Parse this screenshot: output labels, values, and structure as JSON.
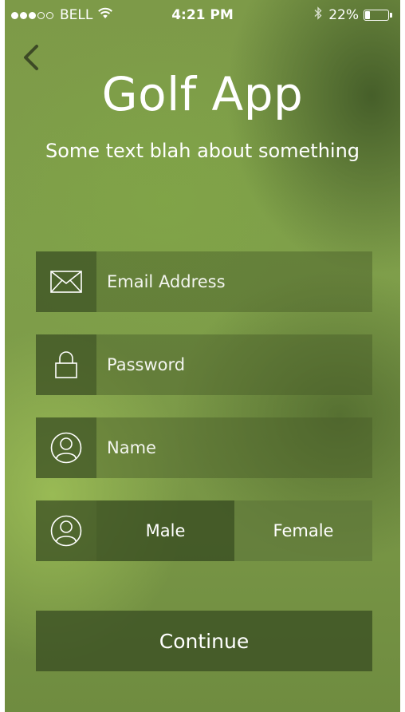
{
  "status_bar": {
    "carrier": "BELL",
    "signal_bars_full": 3,
    "signal_bars_total": 5,
    "time": "4:21 PM",
    "battery_percent": "22%",
    "battery_level": 0.22,
    "icons": [
      "wifi-icon",
      "bluetooth-icon",
      "battery-icon"
    ]
  },
  "header": {
    "back_icon": "chevron-left-icon",
    "title": "Golf App",
    "subtitle": "Some text blah about something"
  },
  "form": {
    "email": {
      "icon": "envelope-icon",
      "placeholder": "Email Address",
      "value": ""
    },
    "password": {
      "icon": "lock-icon",
      "placeholder": "Password",
      "value": ""
    },
    "name": {
      "icon": "user-icon",
      "placeholder": "Name",
      "value": ""
    },
    "gender": {
      "icon": "user-icon",
      "options": [
        "Male",
        "Female"
      ],
      "selected": "Male"
    }
  },
  "continue_label": "Continue",
  "colors": {
    "background_green": "#7d9a48",
    "field_bg": "#5c7436",
    "button_bg": "#4a5f2c",
    "text": "#ffffff"
  }
}
